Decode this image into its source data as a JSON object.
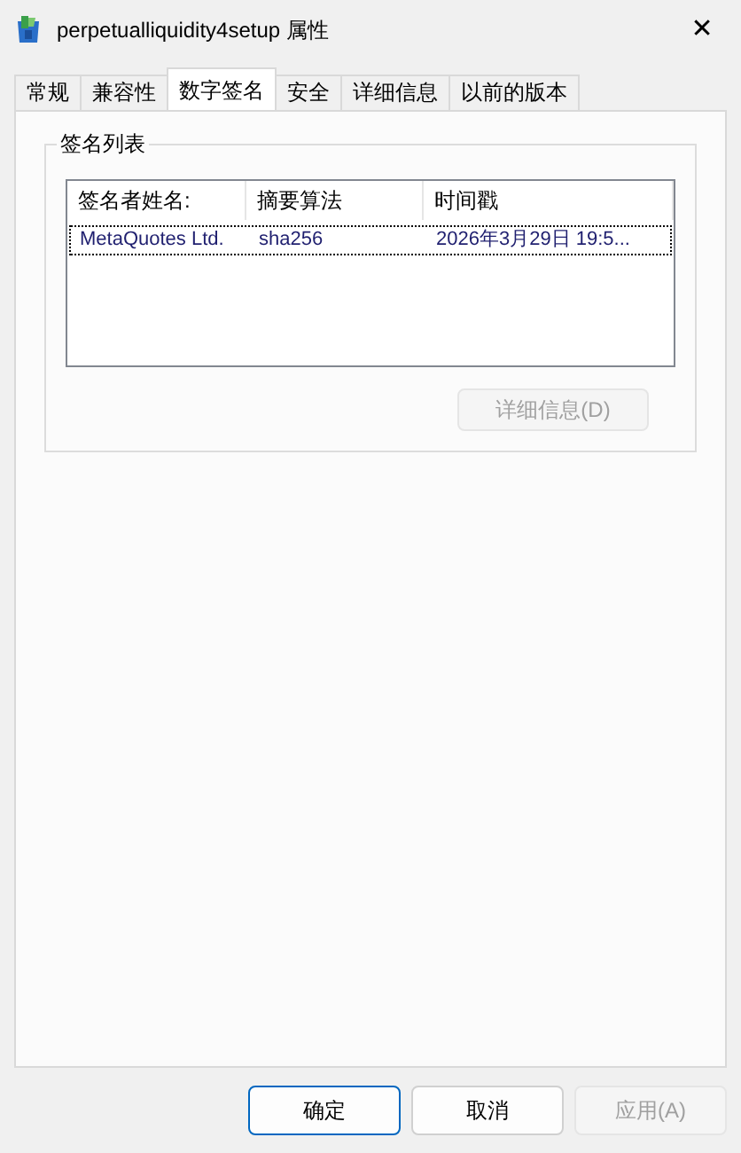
{
  "window": {
    "title": "perpetualliquidity4setup 属性",
    "close": "✕"
  },
  "tabs": [
    {
      "label": "常规",
      "selected": false
    },
    {
      "label": "兼容性",
      "selected": false
    },
    {
      "label": "数字签名",
      "selected": true
    },
    {
      "label": "安全",
      "selected": false
    },
    {
      "label": "详细信息",
      "selected": false
    },
    {
      "label": "以前的版本",
      "selected": false
    }
  ],
  "signature_list": {
    "title": "签名列表",
    "columns": [
      "签名者姓名:",
      "摘要算法",
      "时间戳"
    ],
    "rows": [
      {
        "cells": [
          "MetaQuotes Ltd.",
          "sha256",
          "2026年3月29日 19:5..."
        ],
        "focused": true
      }
    ],
    "details_button": {
      "label": "详细信息(D)",
      "disabled": true
    }
  },
  "buttons": [
    {
      "label": "确定",
      "default": true,
      "disabled": false
    },
    {
      "label": "取消",
      "default": false,
      "disabled": false
    },
    {
      "label": "应用(A)",
      "default": false,
      "disabled": true
    }
  ]
}
